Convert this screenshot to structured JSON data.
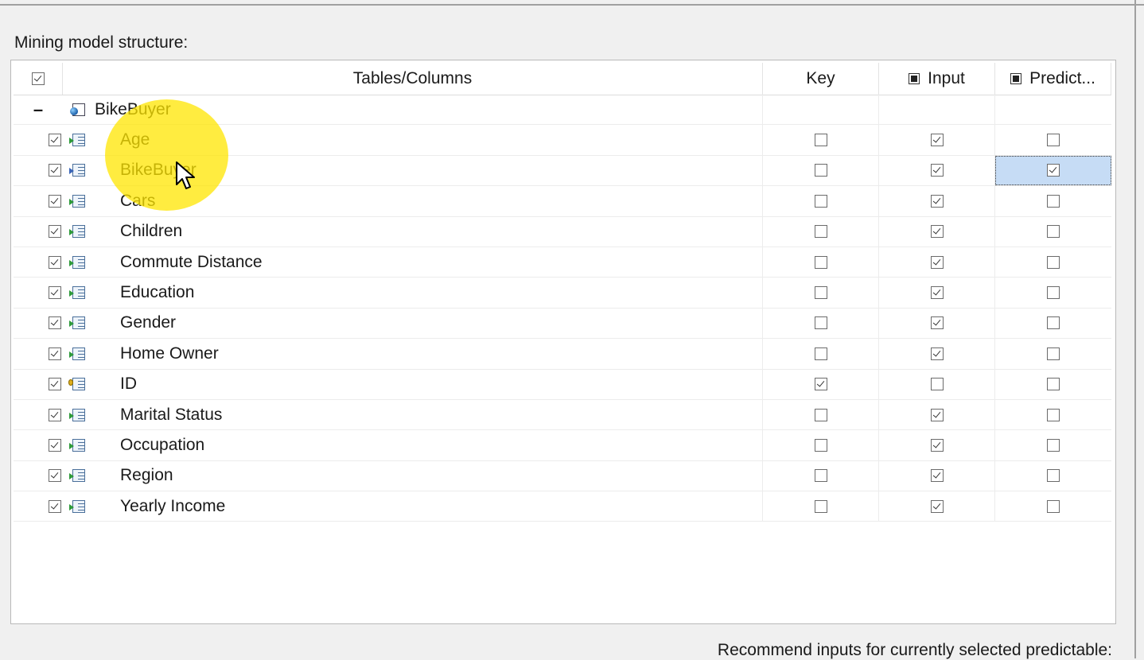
{
  "section_label": "Mining model structure:",
  "columns": {
    "select_all_checked": true,
    "tables_columns": "Tables/Columns",
    "key": "Key",
    "input": "Input",
    "predict": "Predict..."
  },
  "table": {
    "name": "BikeBuyer",
    "expanded": true,
    "toggle_glyph": "–"
  },
  "rows": [
    {
      "name": "Age",
      "selected": true,
      "key": false,
      "input": true,
      "predict": false,
      "icon": "input-column-icon"
    },
    {
      "name": "BikeBuyer",
      "selected": true,
      "key": false,
      "input": true,
      "predict": true,
      "icon": "predict-column-icon"
    },
    {
      "name": "Cars",
      "selected": true,
      "key": false,
      "input": true,
      "predict": false,
      "icon": "input-column-icon"
    },
    {
      "name": "Children",
      "selected": true,
      "key": false,
      "input": true,
      "predict": false,
      "icon": "input-column-icon"
    },
    {
      "name": "Commute Distance",
      "selected": true,
      "key": false,
      "input": true,
      "predict": false,
      "icon": "input-column-icon"
    },
    {
      "name": "Education",
      "selected": true,
      "key": false,
      "input": true,
      "predict": false,
      "icon": "input-column-icon"
    },
    {
      "name": "Gender",
      "selected": true,
      "key": false,
      "input": true,
      "predict": false,
      "icon": "input-column-icon"
    },
    {
      "name": "Home Owner",
      "selected": true,
      "key": false,
      "input": true,
      "predict": false,
      "icon": "input-column-icon"
    },
    {
      "name": "ID",
      "selected": true,
      "key": true,
      "input": false,
      "predict": false,
      "icon": "key-column-icon"
    },
    {
      "name": "Marital Status",
      "selected": true,
      "key": false,
      "input": true,
      "predict": false,
      "icon": "input-column-icon"
    },
    {
      "name": "Occupation",
      "selected": true,
      "key": false,
      "input": true,
      "predict": false,
      "icon": "input-column-icon"
    },
    {
      "name": "Region",
      "selected": true,
      "key": false,
      "input": true,
      "predict": false,
      "icon": "input-column-icon"
    },
    {
      "name": "Yearly Income",
      "selected": true,
      "key": false,
      "input": true,
      "predict": false,
      "icon": "input-column-icon"
    }
  ],
  "bottom_text": "Recommend inputs for currently selected predictable:",
  "colors": {
    "selected_cell": "#c6dcf5",
    "highlight": "#ffe600"
  }
}
